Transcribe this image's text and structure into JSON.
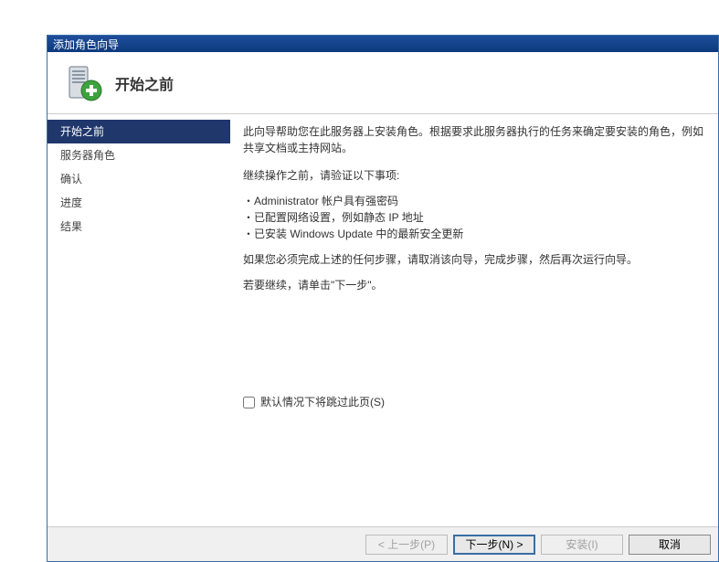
{
  "window": {
    "title": "添加角色向导"
  },
  "header": {
    "title": "开始之前"
  },
  "sidebar": {
    "items": [
      {
        "label": "开始之前",
        "active": true
      },
      {
        "label": "服务器角色",
        "active": false
      },
      {
        "label": "确认",
        "active": false
      },
      {
        "label": "进度",
        "active": false
      },
      {
        "label": "结果",
        "active": false
      }
    ]
  },
  "content": {
    "intro": "此向导帮助您在此服务器上安装角色。根据要求此服务器执行的任务来确定要安装的角色，例如共享文档或主持网站。",
    "verify_heading": "继续操作之前，请验证以下事项:",
    "bullets": [
      "Administrator 帐户具有强密码",
      "已配置网络设置，例如静态 IP 地址",
      "已安装 Windows Update 中的最新安全更新"
    ],
    "cancel_note": "如果您必须完成上述的任何步骤，请取消该向导，完成步骤，然后再次运行向导。",
    "continue_note": "若要继续，请单击\"下一步\"。",
    "skip_checkbox": "默认情况下将跳过此页(S)"
  },
  "footer": {
    "prev": "< 上一步(P)",
    "next": "下一步(N) >",
    "install": "安装(I)",
    "cancel": "取消"
  }
}
